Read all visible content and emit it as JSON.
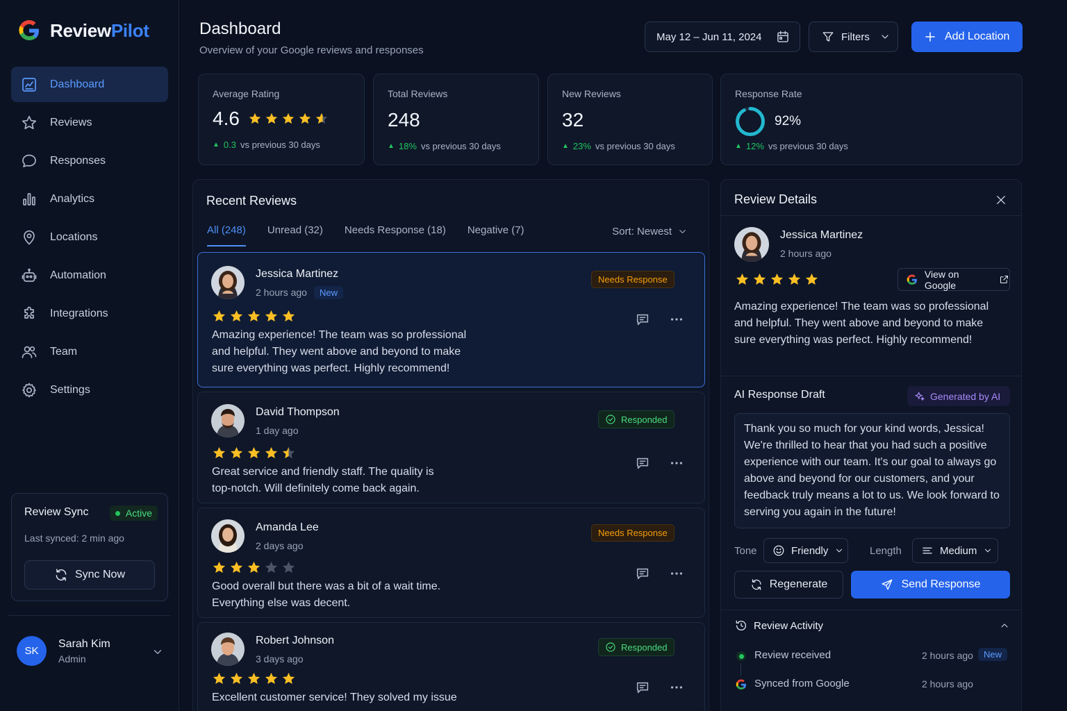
{
  "app": {
    "name_part1": "Review",
    "name_part2": "Pilot"
  },
  "nav": [
    {
      "label": "Dashboard",
      "icon": "dashboard-icon"
    },
    {
      "label": "Reviews",
      "icon": "star-icon"
    },
    {
      "label": "Responses",
      "icon": "chat-icon"
    },
    {
      "label": "Analytics",
      "icon": "bar-chart-icon"
    },
    {
      "label": "Locations",
      "icon": "pin-icon"
    },
    {
      "label": "Automation",
      "icon": "robot-icon"
    },
    {
      "label": "Integrations",
      "icon": "puzzle-icon"
    },
    {
      "label": "Team",
      "icon": "users-icon"
    },
    {
      "label": "Settings",
      "icon": "gear-icon"
    }
  ],
  "sync": {
    "title": "Review Sync",
    "status": "Active",
    "last": "Last synced: 2 min ago",
    "button": "Sync Now"
  },
  "user": {
    "initials": "SK",
    "name": "Sarah Kim",
    "role": "Admin"
  },
  "header": {
    "title": "Dashboard",
    "subtitle": "Overview of your Google reviews and responses",
    "date_range": "May 12 – Jun 11, 2024",
    "filters": "Filters",
    "add_location": "Add Location"
  },
  "stats": {
    "avg": {
      "label": "Average Rating",
      "value": "4.6",
      "rating": 4.6,
      "change": "0.3",
      "suffix": "vs previous 30 days"
    },
    "total": {
      "label": "Total Reviews",
      "value": "248",
      "change": "18%",
      "suffix": "vs previous 30 days"
    },
    "new": {
      "label": "New Reviews",
      "value": "32",
      "change": "23%",
      "suffix": "vs previous 30 days"
    },
    "rate": {
      "label": "Response Rate",
      "value": "92%",
      "percent": 92,
      "change": "12%",
      "suffix": "vs previous 30 days"
    }
  },
  "reviews_panel": {
    "title": "Recent Reviews",
    "tabs": [
      "All (248)",
      "Unread (32)",
      "Needs Response (18)",
      "Negative (7)"
    ],
    "sort": "Sort: Newest"
  },
  "reviews": [
    {
      "name": "Jessica Martinez",
      "time": "2 hours ago",
      "new": "New",
      "rating": 5,
      "status": "Needs Response",
      "text": "Amazing experience! The team was so professional and helpful. They went above and beyond to make sure everything was perfect. Highly recommend!"
    },
    {
      "name": "David Thompson",
      "time": "1 day ago",
      "rating": 4.5,
      "status": "Responded",
      "text": "Great service and friendly staff. The quality is top-notch. Will definitely come back again."
    },
    {
      "name": "Amanda Lee",
      "time": "2 days ago",
      "rating": 3,
      "status": "Needs Response",
      "text": "Good overall but there was a bit of a wait time. Everything else was decent."
    },
    {
      "name": "Robert Johnson",
      "time": "3 days ago",
      "rating": 5,
      "status": "Responded",
      "text": "Excellent customer service! They solved my issue"
    }
  ],
  "details": {
    "title": "Review Details",
    "name": "Jessica Martinez",
    "time": "2 hours ago",
    "rating": 5,
    "view_google": "View on Google",
    "text": "Amazing experience! The team was so professional and helpful. They went above and beyond to make sure everything was perfect. Highly recommend!",
    "ai_title": "AI Response Draft",
    "ai_badge": "Generated by AI",
    "draft": "Thank you so much for your kind words, Jessica! We're thrilled to hear that you had such a positive experience with our team. It's our goal to always go above and beyond for our customers, and your feedback truly means a lot to us. We look forward to serving you again in the future!",
    "tone_label": "Tone",
    "tone": "Friendly",
    "length_label": "Length",
    "length": "Medium",
    "regenerate": "Regenerate",
    "send": "Send Response",
    "activity_title": "Review Activity",
    "activity": [
      {
        "label": "Review received",
        "time": "2 hours ago",
        "badge": "New"
      },
      {
        "label": "Synced from Google",
        "time": "2 hours ago"
      }
    ]
  },
  "colors": {
    "accent": "#2563eb",
    "star": "#fbbf24",
    "success": "#22c55e",
    "warning": "#f59e0b"
  }
}
